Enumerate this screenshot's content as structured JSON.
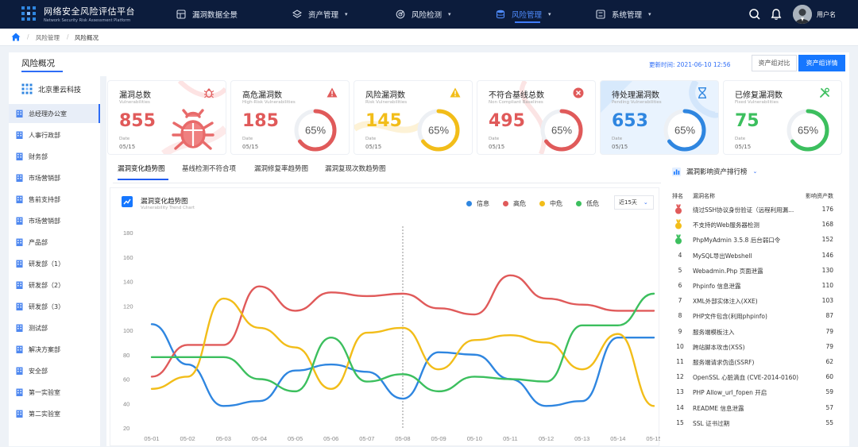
{
  "app": {
    "title_cn": "网络安全风险评估平台",
    "title_en": "Network Security Risk Assessment Platform"
  },
  "nav": [
    {
      "label": "漏洞数据全景",
      "icon": "grid-icon",
      "has_dropdown": false,
      "active": false
    },
    {
      "label": "资产管理",
      "icon": "layers-icon",
      "has_dropdown": true,
      "active": false
    },
    {
      "label": "风险检测",
      "icon": "radar-icon",
      "has_dropdown": true,
      "active": false
    },
    {
      "label": "风险管理",
      "icon": "database-icon",
      "has_dropdown": true,
      "active": true
    },
    {
      "label": "系统管理",
      "icon": "settings-icon",
      "has_dropdown": true,
      "active": false
    }
  ],
  "user": {
    "name": "用户名"
  },
  "breadcrumb": {
    "items": [
      "风险管理",
      "风险概况"
    ],
    "separator": "/"
  },
  "page": {
    "title": "风险概况",
    "update_label": "更新时间: 2021-06-10 12:56",
    "btn_compare": "资产组对比",
    "btn_detail": "资产组详情"
  },
  "sidebar": {
    "org": "北京墨云科技",
    "items": [
      "总经理办公室",
      "人事行政部",
      "财务部",
      "市场营销部",
      "售前支持部",
      "市场营销部",
      "产品部",
      "研发部（1）",
      "研发部（2）",
      "研发部（3）",
      "测试部",
      "解决方案部",
      "安全部",
      "第一实验室",
      "第二实验室"
    ],
    "active_index": 0
  },
  "cards": [
    {
      "title": "漏洞总数",
      "subtitle": "Vulnerabilities",
      "value": "855",
      "date_label": "Date",
      "date": "05/15",
      "color": "#e05a5a",
      "icon": "bug-icon",
      "percent_text": "",
      "percent": null
    },
    {
      "title": "高危漏洞数",
      "subtitle": "High-Risk Vulnerabilities",
      "value": "185",
      "date_label": "Date",
      "date": "05/15",
      "color": "#e05a5a",
      "icon": "warning-icon",
      "percent_text": "65%",
      "percent": 65
    },
    {
      "title": "风险漏洞数",
      "subtitle": "Risk Vulnerabilities",
      "value": "145",
      "date_label": "Date",
      "date": "05/15",
      "color": "#f2bd19",
      "icon": "warning-icon",
      "percent_text": "65%",
      "percent": 65
    },
    {
      "title": "不符合基线总数",
      "subtitle": "Non Compliant Baselines",
      "value": "495",
      "date_label": "Date",
      "date": "05/15",
      "color": "#e05a5a",
      "icon": "close-circle-icon",
      "percent_text": "65%",
      "percent": 65
    },
    {
      "title": "待处理漏洞数",
      "subtitle": "Pending Vulnerabilities",
      "value": "653",
      "date_label": "Date",
      "date": "05/15",
      "color": "#2f86e0",
      "icon": "hourglass-icon",
      "percent_text": "65%",
      "percent": 65
    },
    {
      "title": "已修复漏洞数",
      "subtitle": "Fixed Vulnerabilities",
      "value": "75",
      "date_label": "Date",
      "date": "05/15",
      "color": "#3cbf5e",
      "icon": "tools-icon",
      "percent_text": "65%",
      "percent": 65
    }
  ],
  "tabs": [
    "漏洞变化趋势图",
    "基线检测不符合项",
    "漏洞修复率趋势图",
    "漏洞复现次数趋势图"
  ],
  "active_tab": 0,
  "trend": {
    "title": "漏洞变化趋势图",
    "subtitle": "Vulnerability Trend Chart",
    "range_label": "近15天"
  },
  "chart_data": {
    "type": "line",
    "title": "漏洞变化趋势图",
    "subtitle": "Vulnerability Trend Chart",
    "x": [
      "05-01",
      "05-02",
      "05-03",
      "05-04",
      "05-05",
      "05-06",
      "05-07",
      "05-08",
      "05-09",
      "05-10",
      "05-11",
      "05-12",
      "05-13",
      "05-14",
      "05-15"
    ],
    "ylim": [
      20,
      180
    ],
    "yticks": [
      180,
      160,
      140,
      120,
      100,
      80,
      60,
      40,
      20
    ],
    "grid": false,
    "legend_position": "top-right",
    "series": [
      {
        "name": "信息",
        "color": "#2f86e0",
        "values": [
          105,
          72,
          38,
          42,
          67,
          72,
          66,
          44,
          82,
          80,
          60,
          38,
          42,
          94,
          94
        ]
      },
      {
        "name": "高危",
        "color": "#e05a5a",
        "values": [
          62,
          88,
          88,
          136,
          116,
          131,
          128,
          130,
          118,
          113,
          145,
          126,
          121,
          116,
          116
        ]
      },
      {
        "name": "中危",
        "color": "#f2bd19",
        "values": [
          52,
          62,
          126,
          102,
          86,
          52,
          98,
          102,
          68,
          92,
          96,
          90,
          68,
          97,
          38
        ]
      },
      {
        "name": "低危",
        "color": "#3cbf5e",
        "values": [
          78,
          78,
          78,
          60,
          50,
          94,
          58,
          64,
          50,
          62,
          60,
          58,
          104,
          104,
          130
        ]
      }
    ]
  },
  "ranking": {
    "header": "漏洞影响资产排行榜",
    "col_rank": "排名",
    "col_name": "漏洞名称",
    "col_count": "影响资产数",
    "rows": [
      {
        "rank": "1",
        "name": "绕过SSH协议身份验证（远程利用漏...",
        "count": "176"
      },
      {
        "rank": "2",
        "name": "不支持的Web服务器检测",
        "count": "168"
      },
      {
        "rank": "3",
        "name": "PhpMyAdmin 3.5.8 后台弱口令",
        "count": "152"
      },
      {
        "rank": "4",
        "name": "MySQL导出Webshell",
        "count": "146"
      },
      {
        "rank": "5",
        "name": "Webadmin.Php 页面泄露",
        "count": "130"
      },
      {
        "rank": "6",
        "name": "Phpinfo 信息泄露",
        "count": "110"
      },
      {
        "rank": "7",
        "name": "XML外部实体注入(XXE)",
        "count": "103"
      },
      {
        "rank": "8",
        "name": " PHP文件包含(利用phpinfo)",
        "count": "87"
      },
      {
        "rank": "9",
        "name": "服务端模板注入",
        "count": "79"
      },
      {
        "rank": "10",
        "name": "跨站脚本攻击(XSS)",
        "count": "79"
      },
      {
        "rank": "11",
        "name": "服务端请求伪造(SSRF)",
        "count": "62"
      },
      {
        "rank": "12",
        "name": "OpenSSL 心脏滴血 (CVE-2014-0160)",
        "count": "60"
      },
      {
        "rank": "13",
        "name": "PHP Allow_url_fopen 开启",
        "count": "59"
      },
      {
        "rank": "14",
        "name": "README 信息泄露",
        "count": "57"
      },
      {
        "rank": "15",
        "name": "SSL 证书过期",
        "count": "55"
      }
    ],
    "medal_colors": [
      "#e05a5a",
      "#f2bd19",
      "#3cbf5e"
    ]
  }
}
